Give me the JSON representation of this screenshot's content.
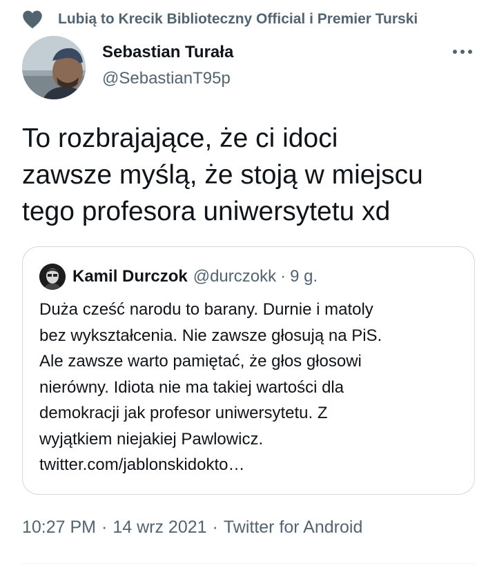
{
  "social_context": {
    "icon": "heart-icon",
    "text": "Lubią to Krecik Biblioteczny Official i Premier Turski"
  },
  "author": {
    "name": "Sebastian Turała",
    "handle": "@SebastianT95p"
  },
  "tweet": {
    "text": "To rozbrajające, że ci idoci\nzawsze myślą, że stoją w miejscu\ntego profesora uniwersytetu xd"
  },
  "quoted_tweet": {
    "author_name": "Kamil Durczok",
    "author_handle": "@durczokk",
    "separator": "·",
    "time": "9 g.",
    "text": "Duża cześć narodu to barany. Durnie i matoly\nbez wykształcenia. Nie zawsze głosują na PiS.\nAle zawsze warto pamiętać, że głos głosowi\nnierówny. Idiota nie ma takiej wartości dla\ndemokracji jak profesor uniwersytetu. Z\nwyjątkiem niejakiej Pawlowicz.\ntwitter.com/jablonskidokto…"
  },
  "meta": {
    "time": "10:27 PM",
    "separator": "·",
    "date": "14 wrz 2021",
    "source": "Twitter for Android"
  },
  "colors": {
    "text_primary": "#0f1419",
    "text_secondary": "#536471",
    "border": "#cfd9de"
  }
}
